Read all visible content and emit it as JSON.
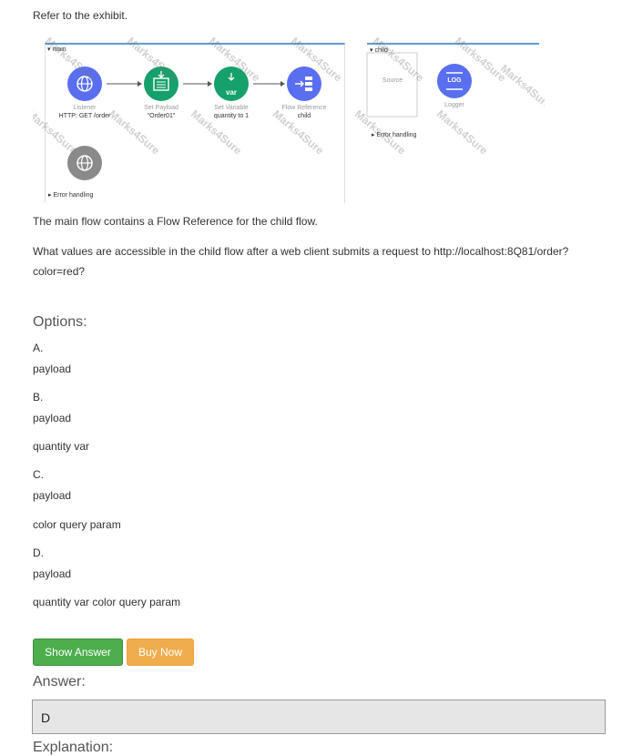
{
  "intro": "Refer to the exhibit.",
  "exhibit": {
    "main_flow": {
      "title": "main",
      "components": [
        {
          "name": "Listener",
          "detail": "HTTP: GET /order",
          "icon": "globe-icon",
          "color": "#5a6ef0"
        },
        {
          "name": "Set Payload",
          "detail": "\"Order01\"",
          "icon": "set-payload-icon",
          "color": "#16a06b"
        },
        {
          "name": "Set Variable",
          "detail": "quantity to 1",
          "icon": "var-icon",
          "color": "#16a06b",
          "icon_text": "var"
        },
        {
          "name": "Flow Reference",
          "detail": "child",
          "icon": "flow-reference-icon",
          "color": "#5a6ef0"
        }
      ],
      "error_source_icon": "globe-icon",
      "error_handling": "Error handling"
    },
    "child_flow": {
      "title": "child",
      "source_label": "Source",
      "components": [
        {
          "name": "Logger",
          "icon": "logger-icon",
          "color": "#5a6ef0",
          "icon_text": "LOG"
        }
      ],
      "error_handling": "Error handling"
    },
    "watermark": "Marks4Sure"
  },
  "context_text": "The main flow contains a Flow Reference for the child flow.",
  "question": {
    "line1": "What values are accessible in the child flow after a web client submits a request to http://localhost:8Q81/order?",
    "line2": "color=red?"
  },
  "options_heading": "Options:",
  "options": [
    {
      "letter": "A.",
      "lines": [
        "payload"
      ]
    },
    {
      "letter": "B.",
      "lines": [
        "payload",
        "quantity var"
      ]
    },
    {
      "letter": "C.",
      "lines": [
        "payload",
        "color query param"
      ]
    },
    {
      "letter": "D.",
      "lines": [
        "payload",
        "quantity var color query param"
      ]
    }
  ],
  "buttons": {
    "show_answer": "Show Answer",
    "buy_now": "Buy Now",
    "show_answer_color": "#4cae4c",
    "buy_now_color": "#f0ad4e"
  },
  "answer_heading": "Answer:",
  "answer": "D",
  "explanation_heading": "Explanation:"
}
